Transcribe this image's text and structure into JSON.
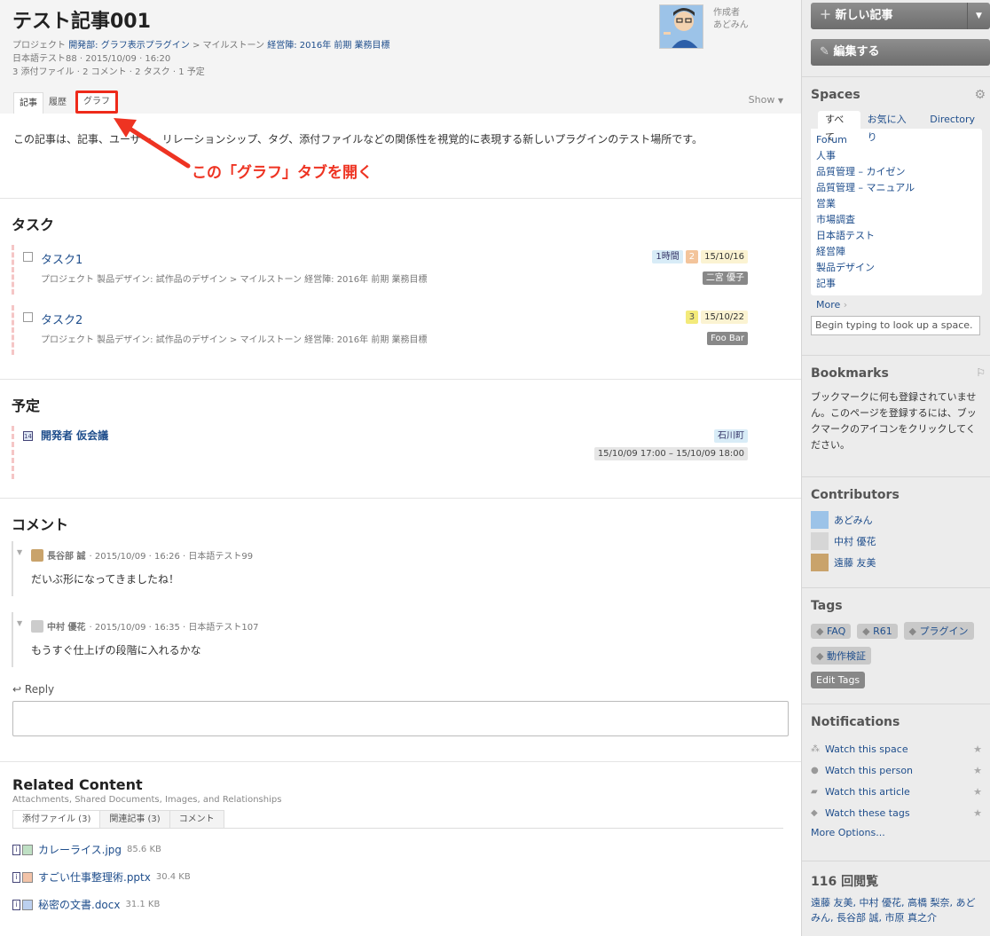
{
  "article": {
    "title": "テスト記事001",
    "meta_project_label": "プロジェクト",
    "meta_project": "開発部: グラフ表示プラグイン",
    "meta_sep": ">",
    "meta_milestone_label": "マイルストーン",
    "meta_milestone": "経営陣: 2016年 前期 業務目標",
    "meta_line2": "日本語テスト88 · 2015/10/09 · 16:20",
    "meta_line3": "3 添付ファイル · 2 コメント · 2 タスク · 1 予定",
    "author_label": "作成者",
    "author_name": "あどみん",
    "tabs": [
      "記事",
      "履歴",
      "グラフ"
    ],
    "show_label": "Show",
    "body": "この記事は、記事、ユーザー、リレーションシップ、タグ、添付ファイルなどの関係性を視覚的に表現する新しいプラグインのテスト場所です。",
    "annotation": "この「グラフ」タブを開く"
  },
  "tasks": {
    "title": "タスク",
    "items": [
      {
        "name": "タスク1",
        "sub": "プロジェクト 製品デザイン: 試作品のデザイン > マイルストーン 経営陣: 2016年 前期 業務目標",
        "time": "1時間",
        "num": "2",
        "date": "15/10/16",
        "assignee": "二宮 優子"
      },
      {
        "name": "タスク2",
        "sub": "プロジェクト 製品デザイン: 試作品のデザイン > マイルストーン 経営陣: 2016年 前期 業務目標",
        "time": "",
        "num": "3",
        "date": "15/10/22",
        "assignee": "Foo Bar"
      }
    ]
  },
  "events": {
    "title": "予定",
    "items": [
      {
        "name": "開発者 仮会議",
        "location": "石川町",
        "time": "15/10/09 17:00 – 15/10/09 18:00"
      }
    ]
  },
  "comments": {
    "title": "コメント",
    "items": [
      {
        "author": "長谷部 誠",
        "meta": "· 2015/10/09 · 16:26 · 日本語テスト99",
        "text": "だいぶ形になってきましたね！"
      },
      {
        "author": "中村 優花",
        "meta": "· 2015/10/09 · 16:35 · 日本語テスト107",
        "text": "もうすぐ仕上げの段階に入れるかな"
      }
    ],
    "reply_label": "Reply"
  },
  "related": {
    "title": "Related Content",
    "subtitle": "Attachments, Shared Documents, Images, and Relationships",
    "tabs": [
      "添付ファイル (3)",
      "関連記事 (3)",
      "コメント"
    ],
    "files": [
      {
        "name": "カレーライス.jpg",
        "size": "85.6 KB"
      },
      {
        "name": "すごい仕事整理術.pptx",
        "size": "30.4 KB"
      },
      {
        "name": "秘密の文書.docx",
        "size": "31.1 KB"
      }
    ]
  },
  "sidebar": {
    "new_article": "新しい記事",
    "edit": "編集する",
    "spaces": {
      "title": "Spaces",
      "tabs": [
        "すべて",
        "お気に入り",
        "Directory"
      ],
      "items": [
        "Forum",
        "人事",
        "品質管理 – カイゼン",
        "品質管理 – マニュアル",
        "営業",
        "市場調査",
        "日本語テスト",
        "経営陣",
        "製品デザイン",
        "記事"
      ],
      "more": "More",
      "lookup_placeholder": "Begin typing to look up a space."
    },
    "bookmarks": {
      "title": "Bookmarks",
      "text": "ブックマークに何も登録されていません。このページを登録するには、ブックマークのアイコンをクリックしてください。"
    },
    "contributors": {
      "title": "Contributors",
      "items": [
        "あどみん",
        "中村 優花",
        "遠藤 友美"
      ]
    },
    "tags": {
      "title": "Tags",
      "items": [
        "FAQ",
        "R61",
        "プラグイン",
        "動作検証"
      ],
      "edit_label": "Edit Tags"
    },
    "notifications": {
      "title": "Notifications",
      "items": [
        "Watch this space",
        "Watch this person",
        "Watch this article",
        "Watch these tags"
      ],
      "more": "More Options..."
    },
    "views": {
      "title": "116 回閲覧",
      "names": "遠藤 友美, 中村 優花, 高橋 梨奈, あどみん, 長谷部 誠, 市原 真之介"
    }
  },
  "colors": {
    "accent_red": "#ee2a1a",
    "link": "#1f4e8c"
  }
}
